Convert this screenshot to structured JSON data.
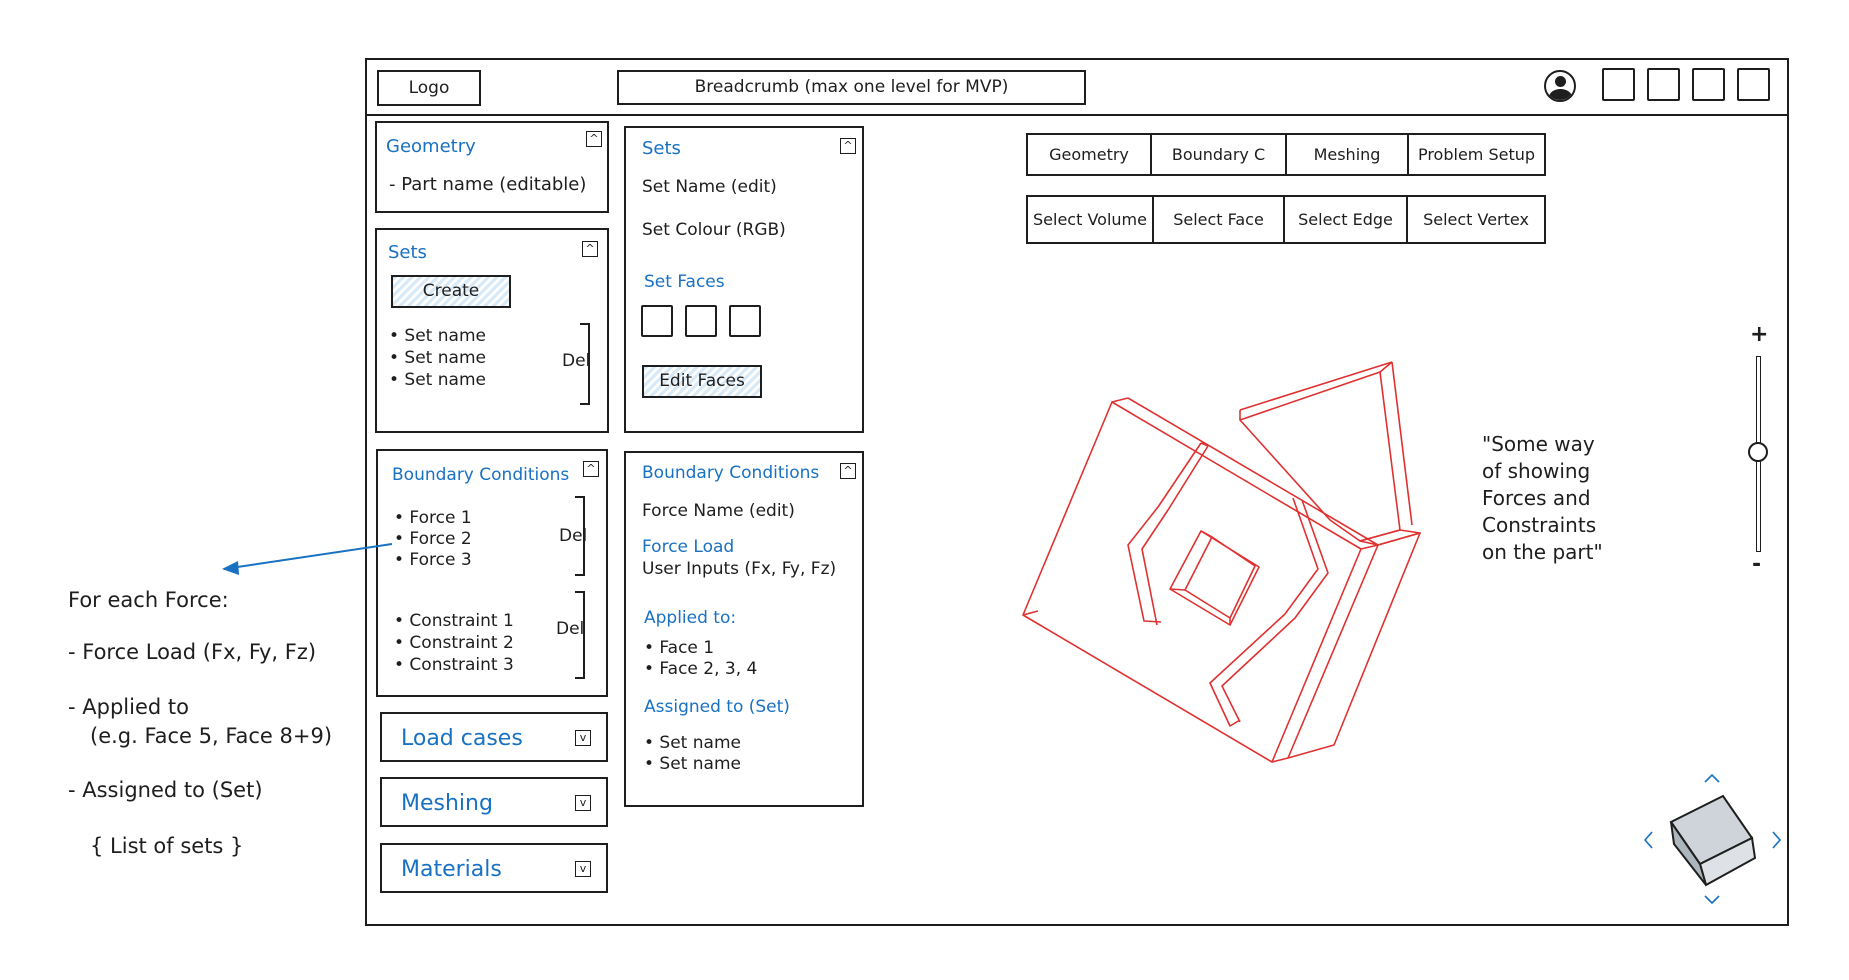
{
  "header": {
    "logo": "Logo",
    "breadcrumb": "Breadcrumb (max one level for MVP)"
  },
  "left_panel": {
    "geometry": {
      "title": "Geometry",
      "item": "- Part name (editable)"
    },
    "sets": {
      "title": "Sets",
      "create": "Create",
      "items": [
        "• Set name",
        "• Set name",
        "• Set name"
      ],
      "del": "Del"
    },
    "boundary": {
      "title": "Boundary Conditions",
      "forces": [
        "• Force 1",
        "• Force 2",
        "• Force 3"
      ],
      "constraints": [
        "• Constraint 1",
        "• Constraint 2",
        "• Constraint 3"
      ],
      "del": "Del"
    },
    "load_cases": "Load cases",
    "meshing": "Meshing",
    "materials": "Materials"
  },
  "mid_panel": {
    "sets": {
      "title": "Sets",
      "name": "Set Name (edit)",
      "colour": "Set Colour (RGB)",
      "faces_title": "Set Faces",
      "edit_faces": "Edit Faces"
    },
    "boundary": {
      "title": "Boundary Conditions",
      "force_name": "Force Name (edit)",
      "force_load": "Force Load",
      "user_inputs": "User Inputs (Fx, Fy, Fz)",
      "applied_to": "Applied to:",
      "faces": [
        "• Face 1",
        "• Face 2, 3, 4"
      ],
      "assigned_to": "Assigned to (Set)",
      "sets": [
        "• Set name",
        "• Set name"
      ]
    }
  },
  "tabs": [
    "Geometry",
    "Boundary C",
    "Meshing",
    "Problem Setup"
  ],
  "select_tabs": [
    "Select Volume",
    "Select Face",
    "Select Edge",
    "Select Vertex"
  ],
  "viewport_note": [
    "\"Some way",
    "of showing",
    "Forces and",
    "Constraints",
    "on the part\""
  ],
  "zoom": {
    "plus": "+",
    "minus": "-"
  },
  "annotation": {
    "title": "For each Force:",
    "lines": [
      "- Force Load (Fx, Fy, Fz)",
      "- Applied to",
      "(e.g. Face 5, Face 8+9)",
      "- Assigned to (Set)",
      "{ List of sets }"
    ]
  },
  "colors": {
    "accent": "#1971c2",
    "model": "#e03131",
    "stroke": "#1e1e1e"
  },
  "icons": [
    "user-icon",
    "collapse-up-icon",
    "collapse-down-icon",
    "view-cube-icon",
    "chevron-up-icon",
    "chevron-down-icon",
    "chevron-left-icon",
    "chevron-right-icon"
  ]
}
